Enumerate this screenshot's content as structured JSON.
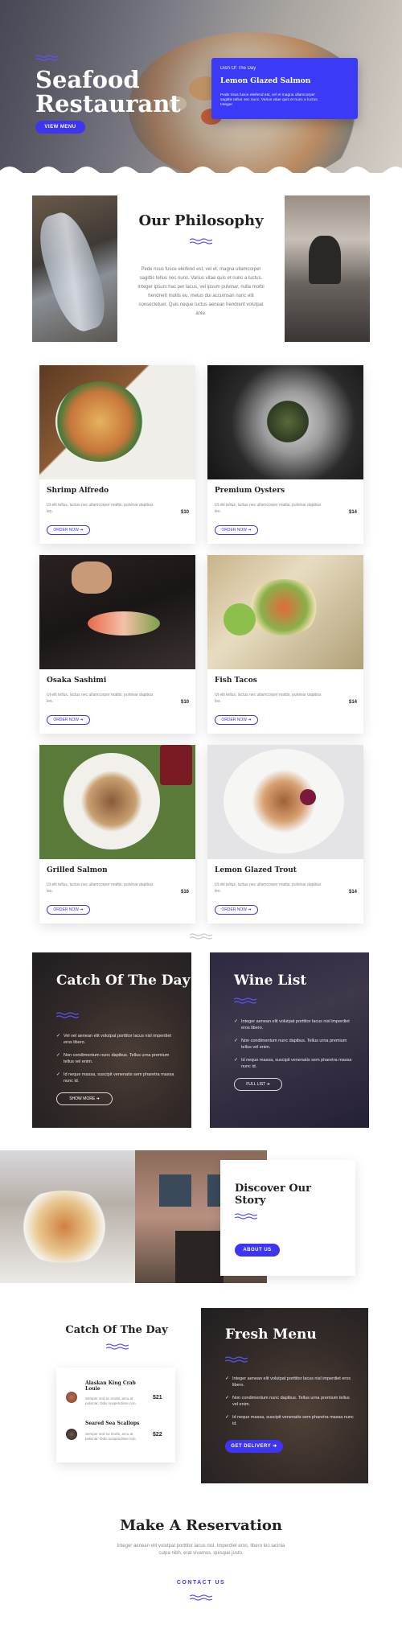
{
  "hero": {
    "title": "Seafood Restaurant",
    "button": "VIEW MENU",
    "dish_label": "Dish Of The Day",
    "dish_name": "Lemon Glazed Salmon",
    "dish_desc": "Pede risus fusce eleifend est, vel et magna ullamcorper sagittis tellus nec nunc. Varius vitae quis et nunc a luctus. Integer."
  },
  "philosophy": {
    "title": "Our Philosophy",
    "text": "Pede risus fusce eleifend est, vel et, magna ullamcorper sagittis tellus nec nunc. Varius vitae quis et nunc a luctus. Integer ipsum hac per lacus, vel ipsum pulvinar, nulla morbi hendrerit mollis eu, metus dui accumsan nunc elit consectetuer. Quis neque luctus aenean hendrerit volutpat ante."
  },
  "menu": {
    "items": [
      {
        "name": "Shrimp Alfredo",
        "desc": "Ut elit tellus, luctus nec ullamcorper mattis, pulvinar dapibus leo.",
        "price": "$10",
        "button": "ORDER NOW"
      },
      {
        "name": "Premium Oysters",
        "desc": "Ut elit tellus, luctus nec ullamcorper mattis, pulvinar dapibus leo.",
        "price": "$14",
        "button": "ORDER NOW"
      },
      {
        "name": "Osaka Sashimi",
        "desc": "Ut elit tellus, luctus nec ullamcorper mattis, pulvinar dapibus leo.",
        "price": "$10",
        "button": "ORDER NOW"
      },
      {
        "name": "Fish Tacos",
        "desc": "Ut elit tellus, luctus nec ullamcorper mattis, pulvinar dapibus leo.",
        "price": "$14",
        "button": "ORDER NOW"
      },
      {
        "name": "Grilled Salmon",
        "desc": "Ut elit tellus, luctus nec ullamcorper mattis, pulvinar dapibus leo.",
        "price": "$16",
        "button": "ORDER NOW"
      },
      {
        "name": "Lemon Glazed Trout",
        "desc": "Ut elit tellus, luctus nec ullamcorper mattis, pulvinar dapibus leo.",
        "price": "$14",
        "button": "ORDER NOW"
      }
    ]
  },
  "catch_panel": {
    "title": "Catch Of The Day",
    "items": [
      "Vel vel aenean elit volutpat porttitor lacus nisl imperdiet eros libero.",
      "Non condimentum nunc dapibus. Tellus urna premium tellus vel enim.",
      "Id neque massa, suscipit venenatis sem pharetra massa nunc id."
    ],
    "button": "SHOW MORE"
  },
  "wine_panel": {
    "title": "Wine List",
    "items": [
      "Integer aenean elit volutpat porttitor lacus nisl imperdiet eros libero.",
      "Non condimentum nunc dapibus. Tellus urna premium tellus vel enim.",
      "Id neque massa, suscipit venenatis sem pharetra massa nunc id."
    ],
    "button": "FULL LIST"
  },
  "story": {
    "title": "Discover Our Story",
    "button": "ABOUT US"
  },
  "catch_list": {
    "title": "Catch Of The Day",
    "items": [
      {
        "name": "Alaskan King Crab Louie",
        "desc": "Semper sed eu morbi, arcu at pulvinar. Odio suspendisse non.",
        "price": "$21"
      },
      {
        "name": "Seared Sea Scallops",
        "desc": "Semper sed eu morbi, arcu at pulvinar. Odio suspendisse non.",
        "price": "$22"
      }
    ]
  },
  "fresh_menu": {
    "title": "Fresh Menu",
    "items": [
      "Integer aenean elit volutpat porttitor lacus nisl imperdiet eros libero.",
      "Non condimentum nunc dapibus. Tellus urna premium tellus vel enim.",
      "Id neque massa, suscipit venenatis sem pharetra massa nunc id."
    ],
    "button": "GET DELIVERY"
  },
  "reservation": {
    "title": "Make A Reservation",
    "text": "Integer aenean elit volutpat porttitor lacus nisl. Imperdiet eros, libero leo lacinia culpa nibh, erat vivamus, quisque justo.",
    "link": "CONTACT US"
  },
  "colors": {
    "accent": "#3d35f0",
    "dark": "#222222"
  }
}
